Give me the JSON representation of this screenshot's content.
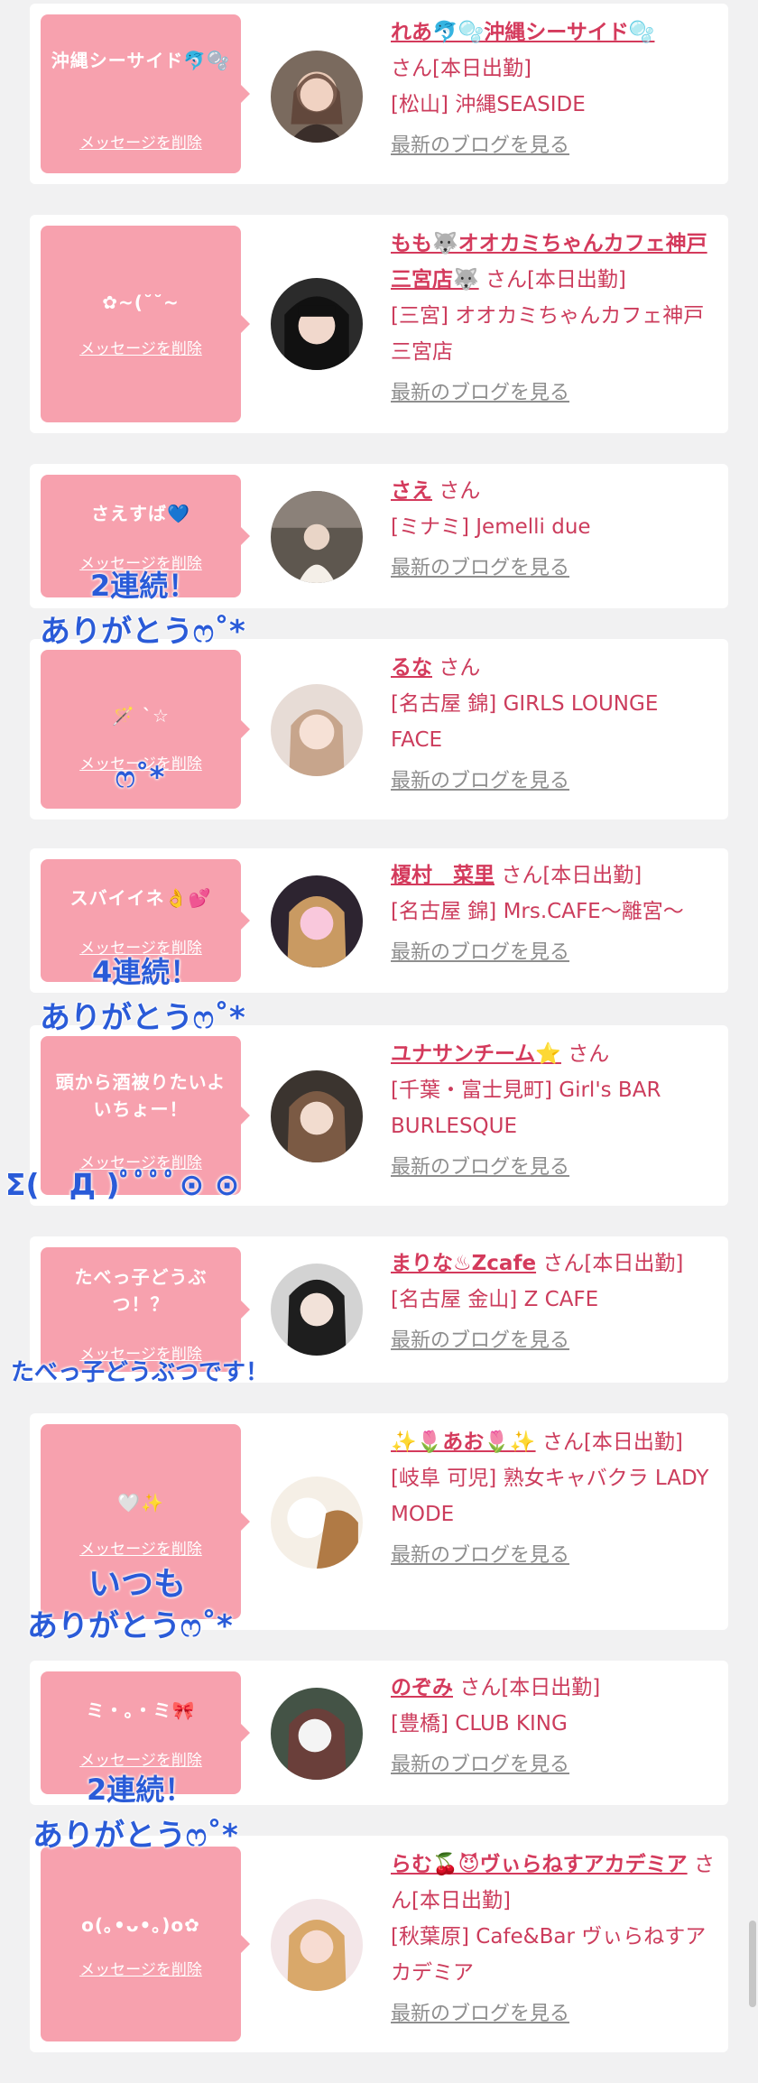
{
  "delete_label": "メッセージを削除",
  "blog_label": "最新のブログを見る",
  "cards": [
    {
      "message": "沖縄シーサイド🐬🫧",
      "name": "れあ🐬🫧沖縄シーサイド🫧",
      "suffix": "さん[本日出勤]",
      "shop": "[松山] 沖縄SEASIDE"
    },
    {
      "message": "✿~(˘˘~",
      "name": "もも🐺オオカミちゃんカフェ神戸三宮店🐺",
      "suffix": "さん[本日出勤]",
      "shop": "[三宮] オオカミちゃんカフェ神戸三宮店"
    },
    {
      "message": "さえすば💙",
      "name": "さえ",
      "suffix": "さん",
      "shop": "[ミナミ] Jemelli due"
    },
    {
      "message": "🪄 ˋ☆",
      "name": "るな",
      "suffix": "さん",
      "shop": "[名古屋 錦] GIRLS LOUNGE FACE"
    },
    {
      "message": "スバイイネ👌💕",
      "name": "榎村　菜里",
      "suffix": "さん[本日出勤]",
      "shop": "[名古屋 錦] Mrs.CAFE〜離宮〜"
    },
    {
      "message": "頭から酒被りたいよいちょー！",
      "name": "ユナサンチーム⭐",
      "suffix": "さん",
      "shop": "[千葉・富士見町] Girl's BAR BURLESQUE"
    },
    {
      "message": "たべっ子どうぶつ！？",
      "name": "まりな♨Zcafe",
      "suffix": "さん[本日出勤]",
      "shop": "[名古屋 金山] Z CAFE"
    },
    {
      "message": "🤍✨",
      "name": "✨🌷あお🌷✨",
      "suffix": "さん[本日出勤]",
      "shop": "[岐阜 可児] 熟女キャバクラ LADY MODE"
    },
    {
      "message": "ミ・。・ミ🎀",
      "name": "のぞみ",
      "suffix": "さん[本日出勤]",
      "shop": "[豊橋] CLUB KING"
    },
    {
      "message": "o(｡•ᴗ•｡)o✿",
      "name": "らむ🍒😈ヴぃらねすアカデミア",
      "suffix": "さん[本日出勤]",
      "shop": "[秋葉原] Cafe&Bar ヴぃらねすアカデミア"
    }
  ],
  "overlays": {
    "o1_line1": "2連続！",
    "o1_line2": "ありがとうෆ˚*",
    "o2": "ෆ˚*",
    "o3_line1": "4連続！",
    "o3_line2": "ありがとうෆ˚*",
    "o4": "Σ(　Д )ﾟﾟﾟﾟ⊙ ⊙",
    "o5": "たべっ子どうぶつです！",
    "o6_line1": "いつも",
    "o6_line2": "ありがとうෆ˚*",
    "o7_line1": "2連続！",
    "o7_line2": "ありがとうෆ˚*"
  },
  "colors": {
    "page_bg": "#f1f1f2",
    "message_bubble": "#f7a1ae",
    "name_text": "#d43a5c",
    "link_text": "#8e8e8e",
    "overlay_text": "#2a5bd8"
  }
}
